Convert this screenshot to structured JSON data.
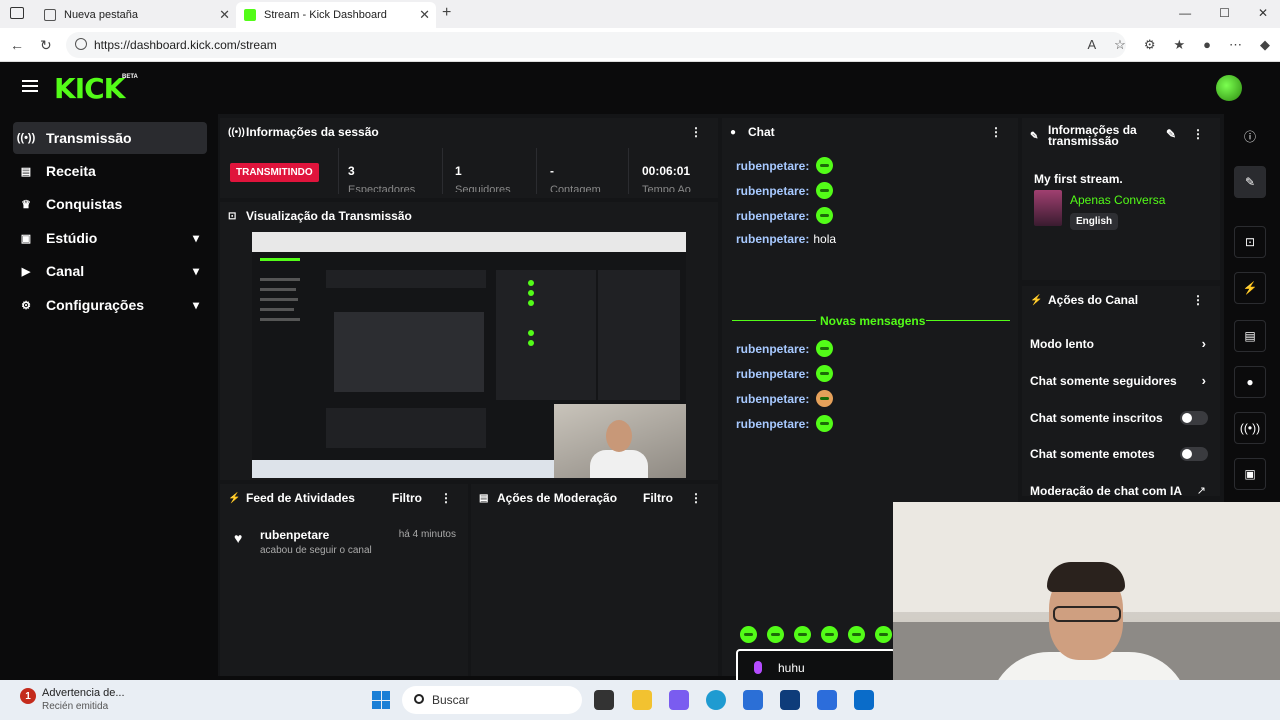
{
  "browser": {
    "tabs": [
      {
        "title": "Nueva pestaña",
        "active": false
      },
      {
        "title": "Stream - Kick Dashboard",
        "active": true
      }
    ],
    "url": "https://dashboard.kick.com/stream"
  },
  "app": {
    "logo": "KICK",
    "beta": "BETA"
  },
  "sidebar": {
    "items": [
      {
        "label": "Transmissão",
        "icon": "broadcast-icon",
        "active": true
      },
      {
        "label": "Receita",
        "icon": "revenue-icon"
      },
      {
        "label": "Conquistas",
        "icon": "trophy-icon"
      },
      {
        "label": "Estúdio",
        "icon": "studio-icon",
        "expandable": true
      },
      {
        "label": "Canal",
        "icon": "channel-icon",
        "expandable": true
      },
      {
        "label": "Configurações",
        "icon": "gear-icon",
        "expandable": true
      }
    ]
  },
  "session": {
    "title": "Informações da sessão",
    "status": "TRANSMITINDO",
    "stats": [
      {
        "value": "3",
        "label": "Espectadores"
      },
      {
        "value": "1",
        "label": "Seguidores"
      },
      {
        "value": "-",
        "label": "Contagem"
      },
      {
        "value": "00:06:01",
        "label": "Tempo Ao"
      }
    ]
  },
  "preview": {
    "title": "Visualização da Transmissão"
  },
  "feed": {
    "title": "Feed de Atividades",
    "filter": "Filtro",
    "items": [
      {
        "user": "rubenpetare",
        "text": "acabou de seguir o canal",
        "time": "há 4 minutos"
      }
    ]
  },
  "moderation": {
    "title": "Ações de Moderação",
    "filter": "Filtro"
  },
  "chat": {
    "title": "Chat",
    "messages_before": [
      {
        "user": "rubenpetare:",
        "text": ""
      },
      {
        "user": "rubenpetare:",
        "text": ""
      },
      {
        "user": "rubenpetare:",
        "text": ""
      },
      {
        "user": "rubenpetare:",
        "text": "hola"
      }
    ],
    "new_messages": "Novas mensagens",
    "messages_after": [
      {
        "user": "rubenpetare:",
        "text": ""
      },
      {
        "user": "rubenpetare:",
        "text": ""
      },
      {
        "user": "rubenpetare:",
        "text": ""
      },
      {
        "user": "rubenpetare:",
        "text": ""
      }
    ],
    "input_value": "huhu"
  },
  "stream_info": {
    "title": "Informações da transmissão",
    "stream_title": "My first stream.",
    "category": "Apenas Conversa",
    "language": "English"
  },
  "channel_actions": {
    "title": "Ações do Canal",
    "items": [
      {
        "label": "Modo lento",
        "control": "arrow"
      },
      {
        "label": "Chat somente seguidores",
        "control": "arrow"
      },
      {
        "label": "Chat somente inscritos",
        "control": "toggle",
        "on": false
      },
      {
        "label": "Chat somente emotes",
        "control": "toggle",
        "on": false
      },
      {
        "label": "Moderação de chat com IA",
        "control": "external"
      }
    ]
  },
  "taskbar": {
    "notification_title": "Advertencia de...",
    "notification_sub": "Recién emitida",
    "notification_badge": "1",
    "search_label": "Buscar"
  },
  "colors": {
    "accent": "#53fc18",
    "live": "#e0143c",
    "username": "#a7c9ff"
  }
}
